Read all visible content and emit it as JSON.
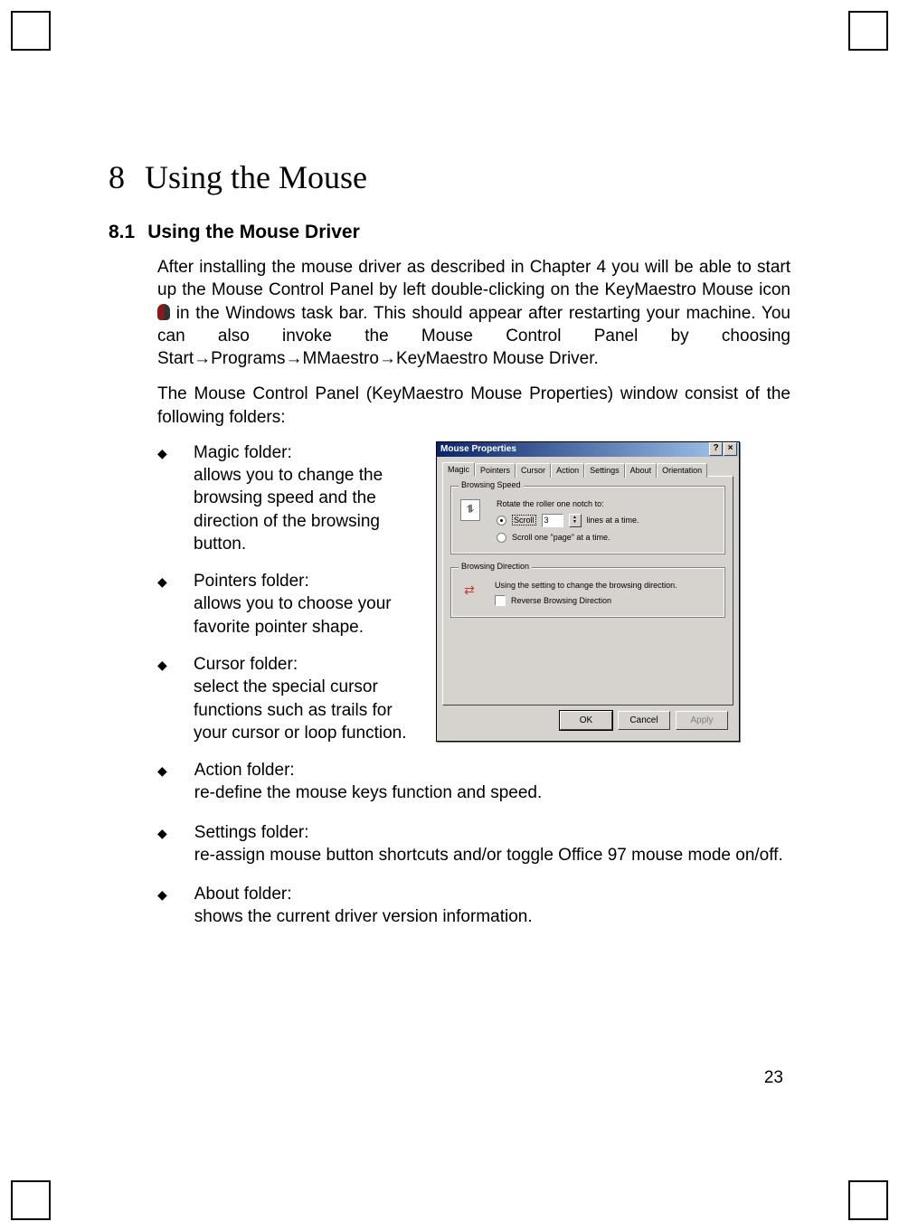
{
  "chapter": {
    "number": "8",
    "title": "Using the Mouse"
  },
  "section": {
    "number": "8.1",
    "title": "Using the Mouse Driver"
  },
  "paragraphs": {
    "p1a": "After installing the mouse driver as described in Chapter 4 you will be able to start up the Mouse Control Panel by left double-clicking on the KeyMaestro Mouse icon",
    "p1b": " in the Windows task bar. This should appear after restarting your machine. You can also invoke the Mouse Control Panel by choosing Start→Programs→MMaestro→KeyMaestro Mouse Driver.",
    "p2": "The Mouse Control Panel (KeyMaestro Mouse Properties) window consist of the following folders:"
  },
  "bullets": [
    {
      "title": "Magic folder:",
      "desc": "allows you to change the browsing speed and the direction of the browsing button."
    },
    {
      "title": "Pointers folder:",
      "desc": "allows you to choose your favorite pointer shape."
    },
    {
      "title": "Cursor folder:",
      "desc": "select the special cursor functions such as trails for your cursor or loop function."
    },
    {
      "title": "Action folder:",
      "desc": "re-define the mouse keys function and speed."
    },
    {
      "title": "Settings folder:",
      "desc": "re-assign mouse button shortcuts and/or toggle Office 97 mouse mode on/off."
    },
    {
      "title": "About folder:",
      "desc": "shows the current driver version information."
    }
  ],
  "bullet_marker": "◆",
  "dialog": {
    "title": "Mouse Properties",
    "help_btn": "?",
    "close_btn": "×",
    "tabs": [
      "Magic",
      "Pointers",
      "Cursor",
      "Action",
      "Settings",
      "About",
      "Orientation"
    ],
    "group_speed": {
      "legend": "Browsing Speed",
      "label_top": "Rotate the roller one notch to:",
      "radio_scroll": "Scroll",
      "lines_value": "3",
      "lines_suffix": "lines at a time.",
      "radio_page": "Scroll one \"page\" at a time."
    },
    "group_direction": {
      "legend": "Browsing Direction",
      "label": "Using the setting to change the browsing direction.",
      "checkbox": "Reverse Browsing Direction"
    },
    "buttons": {
      "ok": "OK",
      "cancel": "Cancel",
      "apply": "Apply"
    }
  },
  "page_number": "23"
}
